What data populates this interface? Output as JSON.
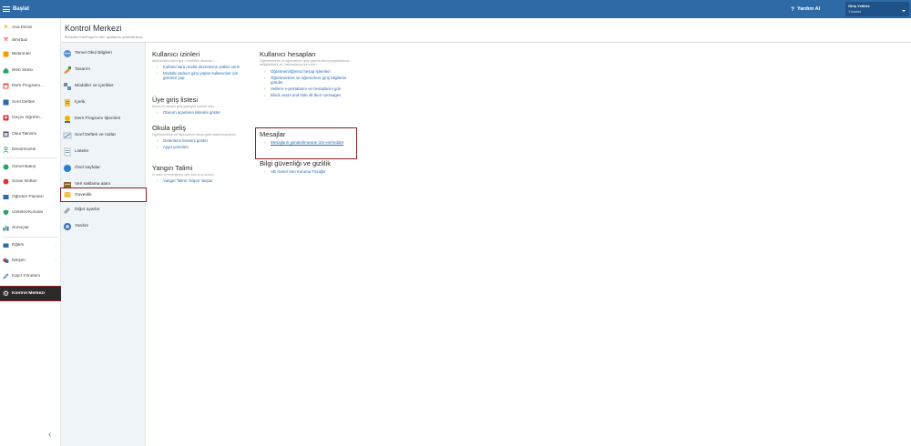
{
  "topbar": {
    "menu_label": "Başlat",
    "help_label": "Yardım AI",
    "login_label": "Giriş Yetkisi:",
    "login_role": "Yönetici"
  },
  "sidebar": {
    "items": [
      {
        "label": "Ana Ekran",
        "icon": "star-icon",
        "color": "#f0b400"
      },
      {
        "label": "Sihirbaz",
        "icon": "wand-icon",
        "color": "#d9363e"
      },
      {
        "label": "Bildirimler",
        "icon": "bell-icon",
        "color": "#f29d00"
      },
      {
        "label": "Web Sitesi",
        "icon": "house-icon",
        "color": "#2aa36b"
      },
      {
        "label": "Ders Programı...",
        "icon": "calendar-icon",
        "color": "#e0574b"
      },
      {
        "label": "Sınıf Defteri",
        "icon": "book-icon",
        "color": "#2d6aa6"
      },
      {
        "label": "Geçici Öğretm...",
        "icon": "person-icon",
        "color": "#d9363e"
      },
      {
        "label": "Okul Takvimi",
        "icon": "calendar-grid-icon",
        "color": "#4b5563"
      },
      {
        "label": "Devamsızlık",
        "icon": "person-outline-icon",
        "color": "#2aa36b"
      },
      {
        "label": "Genel Bakış",
        "icon": "check-circle-icon",
        "color": "#2aa36b"
      },
      {
        "label": "Sınav Notları",
        "icon": "grade-circle-icon",
        "color": "#d9363e"
      },
      {
        "label": "Öğretim Planları",
        "icon": "plan-icon",
        "color": "#2d6aa6"
      },
      {
        "label": "Üniteler/Konular",
        "icon": "shield-icon",
        "color": "#2aa36b"
      },
      {
        "label": "Sonuçlar",
        "icon": "bar-chart-icon",
        "color": "#2d6aa6"
      },
      {
        "label": "Eğitim",
        "icon": "education-icon",
        "color": "#2d6aa6"
      },
      {
        "label": "İletişim",
        "icon": "chat-icon",
        "color": "#d9363e"
      },
      {
        "label": "Kayıt Yönetimi",
        "icon": "pencil-icon",
        "color": "#2d6aa6"
      },
      {
        "label": "Kontrol Merkezi",
        "icon": "gear-icon",
        "color": "#ffffff"
      }
    ]
  },
  "header": {
    "title": "Kontrol Merkezi",
    "subtitle": "Buradan EduPage'in tüm ayarlarını görebilirsiniz."
  },
  "subnav": {
    "items": [
      {
        "label": "Temel Okul Bilgileri",
        "icon": "globe-icon"
      },
      {
        "label": "Tasarım",
        "icon": "paintbrush-icon"
      },
      {
        "label": "Modüller ve içerikler",
        "icon": "modules-icon"
      },
      {
        "label": "İçerik",
        "icon": "document-icon"
      },
      {
        "label": "Ders Programı İşlemleri",
        "icon": "person-clock-icon"
      },
      {
        "label": "Sınıf Defteri ve notlar",
        "icon": "notebook-icon"
      },
      {
        "label": "Listeler",
        "icon": "list-icon"
      },
      {
        "label": "Özel sayfalar",
        "icon": "cloud-icon"
      },
      {
        "label": "Veri saklama alanı",
        "icon": "archive-icon"
      },
      {
        "label": "Güvenlik",
        "icon": "lock-icon"
      },
      {
        "label": "Diğer ayarlar",
        "icon": "tools-icon"
      },
      {
        "label": "Yardım",
        "icon": "help-globe-icon"
      }
    ]
  },
  "sections": {
    "user_permissions": {
      "title": "Kullanıcı izinleri",
      "desc": "aktif kullanıcıların göz / modülleri düzenle / ...",
      "links": [
        "Kullanıcılara modül düzenleme yetkisi verin",
        "Modülü sadece giriş yapan kullanıcılar için görünür yap"
      ]
    },
    "member_login": {
      "title": "Üye giriş listesi",
      "desc": "Kimin ne zaman giriş yaptığını kontrol edin.",
      "links": [
        "Oturum açanların listesini göster"
      ]
    },
    "school_entry": {
      "title": "Okula geliş",
      "desc": "Öğretmenlerin ve öğrencilerin okula geliş saatini kaydedin",
      "links": [
        "Gelenlerin listesini göster",
        "Aygıt yönetimi"
      ]
    },
    "fire_drill": {
      "title": "Yangın Talimi",
      "desc": "In case of emergency see who is at school",
      "links": [
        "Yangın Talimi: Rapor oluştur"
      ]
    },
    "user_accounts": {
      "title": "Kullanıcı hesapları",
      "desc": "Öğretmenlerin ve öğrencilerin giriş yapma ders programlarına, değişikliklere vb. bakmalarına izin verin.",
      "links": [
        "Öğretmen/öğrenci hesap işlemleri",
        "Öğretmenlere ve öğrencilere giriş bilgilerini gönder",
        "Velilere e-postalarını ve hesaplarını gön",
        "Block users and hide all their messages"
      ]
    },
    "messages": {
      "title": "Mesajlar",
      "links": [
        "Mesajların gönderilmesine izin ver/reddet"
      ]
    },
    "privacy": {
      "title": "Bilgi güvenliği ve gizlilik",
      "links": [
        "AB Genel Veri Koruma Tüzüğü"
      ]
    }
  }
}
